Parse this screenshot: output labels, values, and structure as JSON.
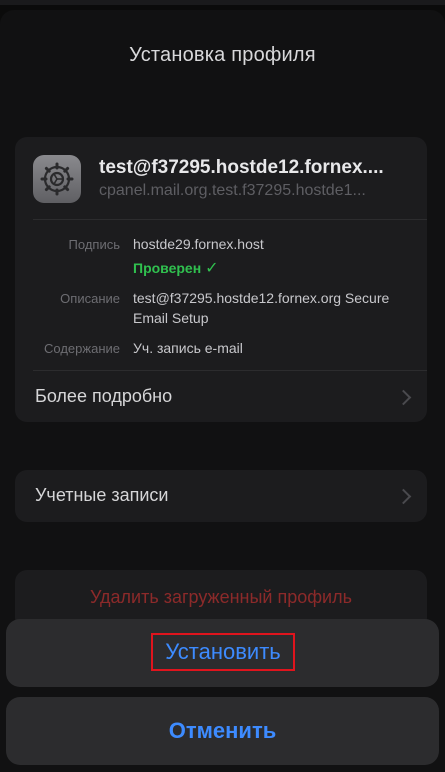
{
  "header": {
    "title": "Установка профиля"
  },
  "profile": {
    "icon": "gear-settings-icon",
    "name": "test@f37295.hostde12.fornex....",
    "identifier": "cpanel.mail.org.test.f37295.hostde1...",
    "signature_label": "Подпись",
    "signature_value": "hostde29.fornex.host",
    "verified_text": "Проверен",
    "verified_mark": "✓",
    "description_label": "Описание",
    "description_value": "test@f37295.hostde12.fornex.org Secure Email Setup",
    "contents_label": "Содержание",
    "contents_value": "Уч. запись e-mail",
    "more_details": "Более подробно"
  },
  "accounts": {
    "label": "Учетные записи"
  },
  "delete": {
    "label": "Удалить загруженный профиль"
  },
  "actions": {
    "install": "Установить",
    "cancel": "Отменить"
  },
  "colors": {
    "accent": "#3d8bff",
    "verified": "#30c04f",
    "destructive": "#8c2a2a",
    "highlight_border": "#e0141d"
  }
}
